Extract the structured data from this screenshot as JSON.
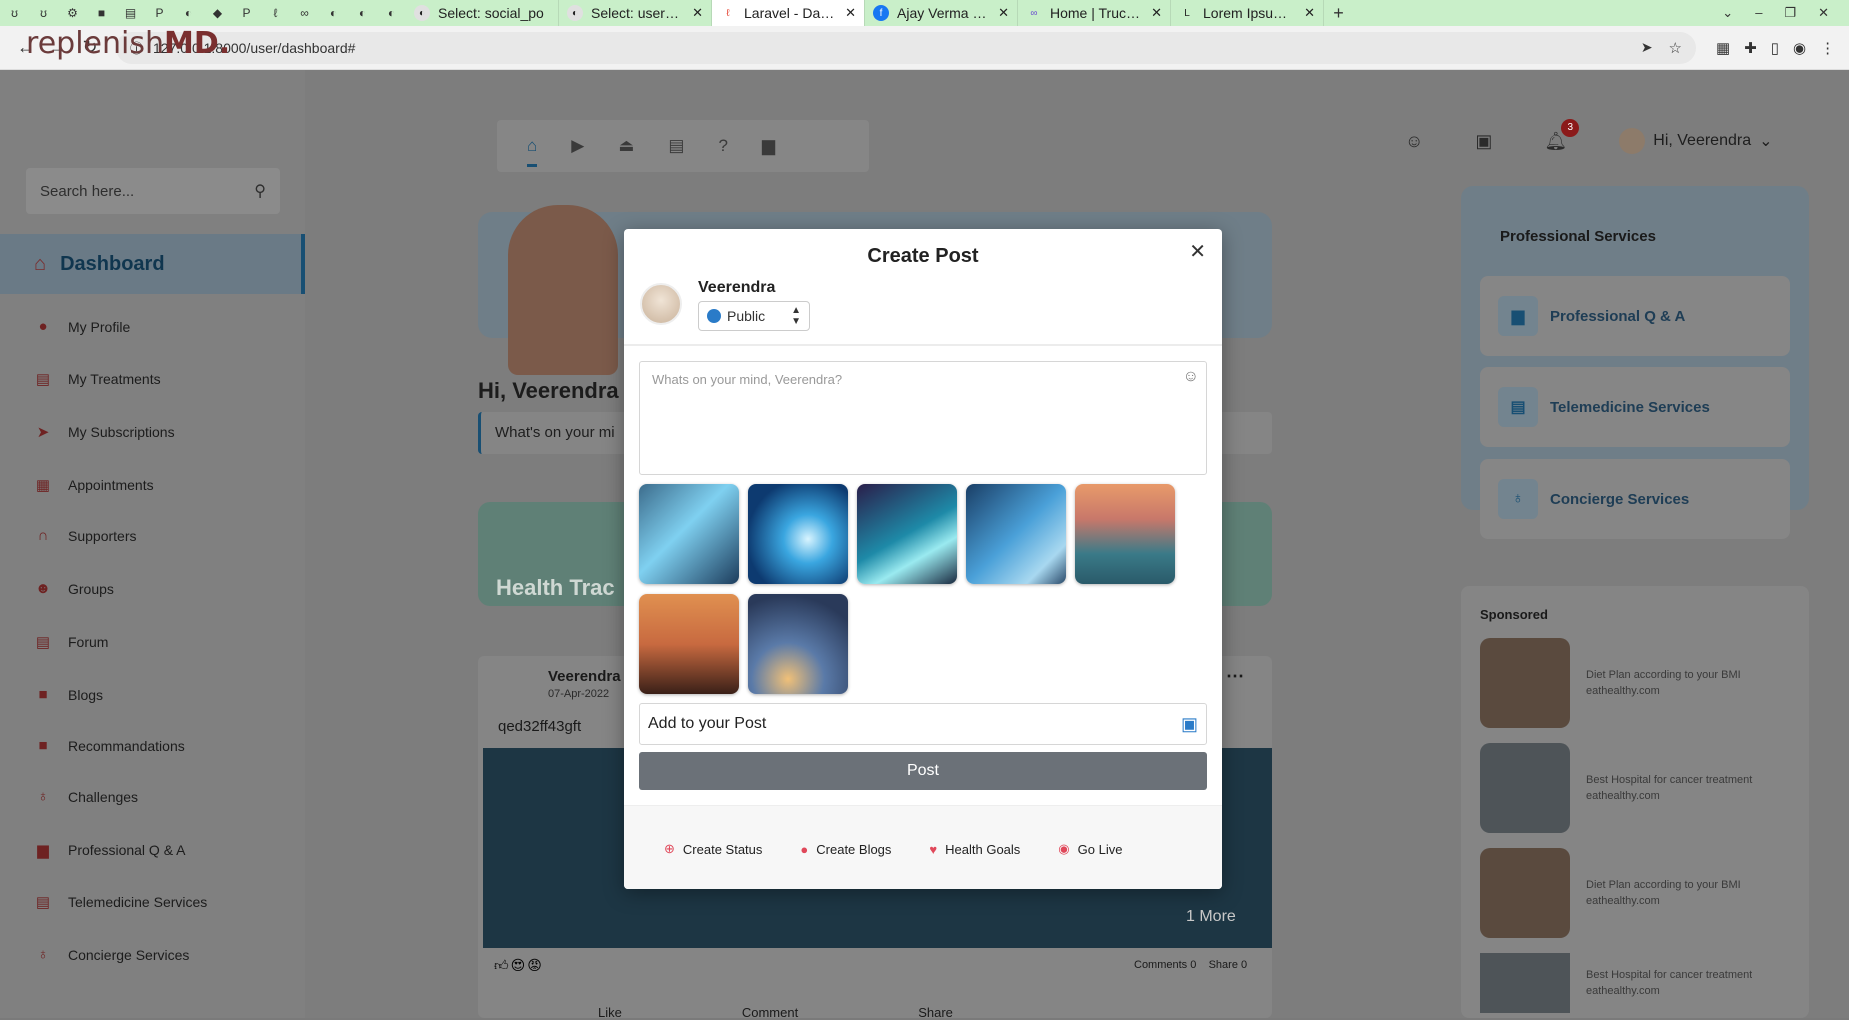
{
  "browser": {
    "favicons": [
      "ʊ",
      "ʊ",
      "⚙",
      "■",
      "▤",
      "P",
      "◐",
      "◆",
      "P",
      "ℓ",
      "∞",
      "◐",
      "◐",
      "◐"
    ],
    "tabs": [
      {
        "label": "Select: social_po",
        "icon": "globe-icon"
      },
      {
        "label": "Select: users - Ad",
        "icon": "globe-icon"
      },
      {
        "label": "Laravel - Dashbo",
        "icon": "laravel-icon",
        "active": true
      },
      {
        "label": "Ajay Verma | Face",
        "icon": "facebook-icon"
      },
      {
        "label": "Home | Trucker H",
        "icon": "trucker-icon"
      },
      {
        "label": "Lorem Ipsum - Al",
        "icon": "lorem-icon"
      }
    ],
    "url": "127.0.0.1:8000/user/dashboard#"
  },
  "sidebar": {
    "logo_prefix": "r",
    "logo_text": "eplenish",
    "logo_suffix": "MD.",
    "search_placeholder": "Search here...",
    "dashboard": "Dashboard",
    "items": [
      {
        "label": "My Profile",
        "icon": "user-icon"
      },
      {
        "label": "My Treatments",
        "icon": "clipboard-icon"
      },
      {
        "label": "My Subscriptions",
        "icon": "send-icon"
      },
      {
        "label": "Appointments",
        "icon": "calendar-icon"
      },
      {
        "label": "Supporters",
        "icon": "headset-icon"
      },
      {
        "label": "Groups",
        "icon": "users-icon"
      },
      {
        "label": "Forum",
        "icon": "clipboard-icon"
      },
      {
        "label": "Blogs",
        "icon": "book-icon"
      },
      {
        "label": "Recommandations",
        "icon": "book-icon"
      },
      {
        "label": "Challenges",
        "icon": "stethoscope-icon"
      },
      {
        "label": "Professional Q & A",
        "icon": "chat-icon"
      },
      {
        "label": "Telemedicine Services",
        "icon": "clipboard-icon"
      },
      {
        "label": "Concierge Services",
        "icon": "stethoscope-icon"
      }
    ]
  },
  "header": {
    "greeting_user": "Hi, Veerendra",
    "notification_count": "3"
  },
  "feed": {
    "greeting": "Hi, Veerendra",
    "mind_prompt": "What's on your mi",
    "health_label": "Health Trac",
    "post": {
      "author": "Veerendra",
      "date": "07-Apr-2022",
      "text": "qed32ff43gft",
      "more": "1 More",
      "comments": "Comments 0",
      "shares": "Share 0",
      "actions": [
        "Like",
        "Comment",
        "Share"
      ]
    }
  },
  "right": {
    "title": "Professional Services",
    "services": [
      "Professional Q & A",
      "Telemedicine Services",
      "Concierge Services"
    ],
    "sponsored_title": "Sponsored",
    "sponsored": [
      {
        "title": "Diet Plan according to your BMI",
        "source": "eathealthy.com"
      },
      {
        "title": "Best Hospital for cancer treatment",
        "source": "eathealthy.com"
      },
      {
        "title": "Diet Plan according to your BMI",
        "source": "eathealthy.com"
      },
      {
        "title": "Best Hospital for cancer treatment",
        "source": "eathealthy.com"
      }
    ]
  },
  "modal": {
    "title": "Create Post",
    "user": "Veerendra",
    "privacy": "Public",
    "composer_placeholder": "Whats on your mind, Veerendra?",
    "add_to_post": "Add to your Post",
    "post_button": "Post",
    "footer_actions": [
      {
        "label": "Create Status",
        "icon": "plus-circle-icon"
      },
      {
        "label": "Create Blogs",
        "icon": "chat-bubble-icon"
      },
      {
        "label": "Health Goals",
        "icon": "heart-pulse-icon"
      },
      {
        "label": "Go Live",
        "icon": "record-icon"
      }
    ],
    "colors": {
      "post_button": "#6b7178",
      "accent": "#e0485a"
    }
  }
}
